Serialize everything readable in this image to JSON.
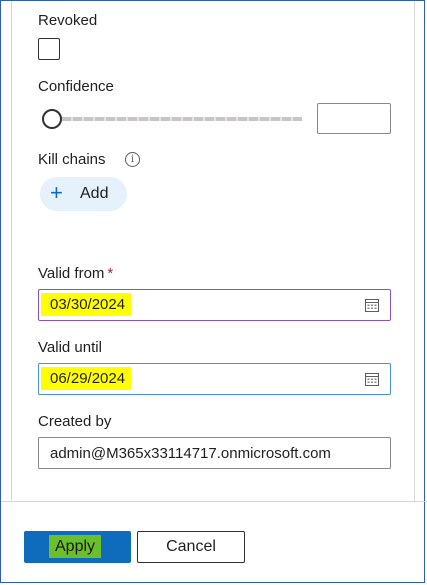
{
  "revoked": {
    "label": "Revoked",
    "checked": false
  },
  "confidence": {
    "label": "Confidence",
    "value": 0,
    "min": 0,
    "max": 100,
    "input_value": ""
  },
  "kill_chains": {
    "label": "Kill chains",
    "info_icon": "info-icon",
    "add_label": "Add",
    "add_icon": "plus-icon"
  },
  "valid_from": {
    "label": "Valid from",
    "required_marker": "*",
    "value": "03/30/2024",
    "icon": "calendar-icon"
  },
  "valid_until": {
    "label": "Valid until",
    "value": "06/29/2024",
    "icon": "calendar-icon"
  },
  "created_by": {
    "label": "Created by",
    "value": "admin@M365x33114717.onmicrosoft.com"
  },
  "footer": {
    "apply_label": "Apply",
    "cancel_label": "Cancel"
  },
  "colors": {
    "accent": "#0f6cbd",
    "highlight_yellow": "#ffff00",
    "highlight_green": "#6bbf2a",
    "required": "#a4262c"
  }
}
